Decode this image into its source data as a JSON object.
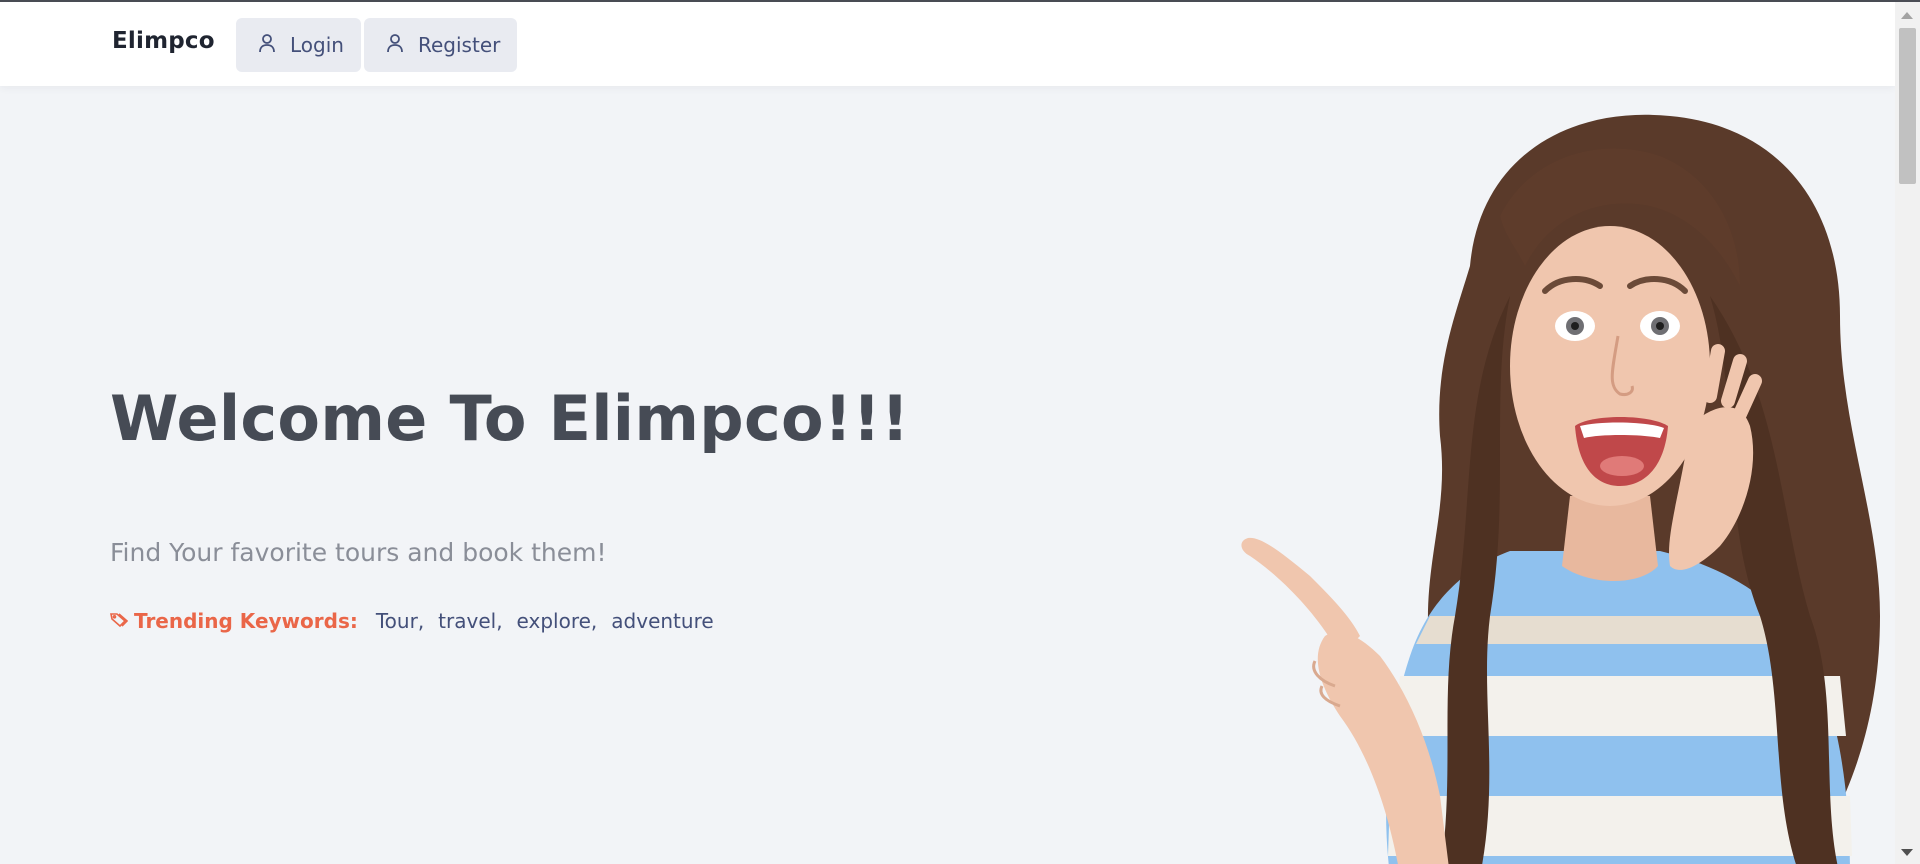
{
  "navbar": {
    "brand": "Elimpco",
    "login_label": "Login",
    "register_label": "Register"
  },
  "hero": {
    "title": "Welcome To Elimpco!!!",
    "subtitle": "Find Your favorite tours and book them!",
    "trending_label": "Trending Keywords:",
    "keywords": [
      "Tour,",
      "travel,",
      "explore,",
      "adventure"
    ]
  },
  "icons": {
    "login": "user-icon",
    "register": "user-icon",
    "trending": "tag-icon"
  },
  "colors": {
    "accent": "#ea6648",
    "nav_text": "#44507a",
    "title": "#464b55",
    "background": "#f2f4f7"
  }
}
